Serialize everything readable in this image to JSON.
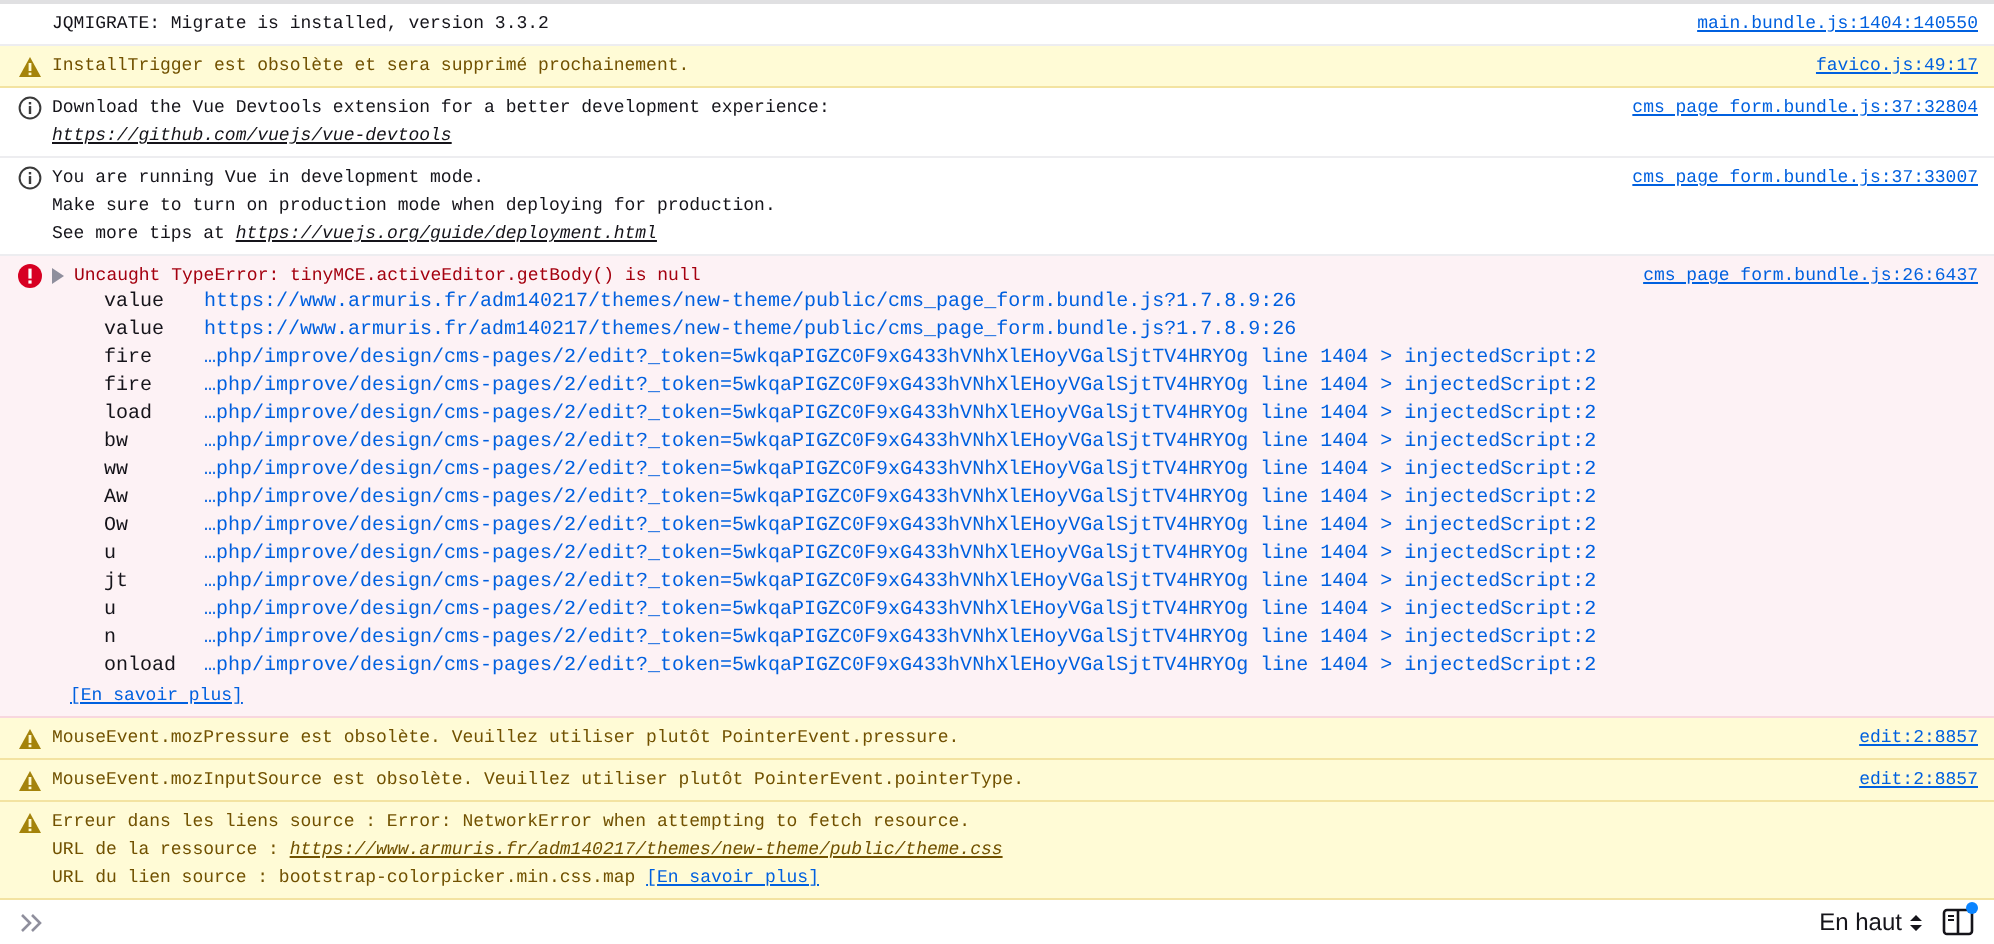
{
  "messages": [
    {
      "kind": "log",
      "lines": [
        [
          {
            "kind": "plain",
            "text": "JQMIGRATE: Migrate is installed, version 3.3.2"
          }
        ]
      ],
      "source": "main.bundle.js:1404:140550"
    },
    {
      "kind": "warning",
      "lines": [
        [
          {
            "kind": "plain",
            "text": "InstallTrigger est obsolète et sera supprimé prochainement."
          }
        ]
      ],
      "source": "favico.js:49:17"
    },
    {
      "kind": "info",
      "lines": [
        [
          {
            "kind": "plain",
            "text": "Download the Vue Devtools extension for a better development experience:"
          }
        ],
        [
          {
            "kind": "url",
            "text": "https://github.com/vuejs/vue-devtools"
          }
        ]
      ],
      "source": "cms page form.bundle.js:37:32804"
    },
    {
      "kind": "info",
      "lines": [
        [
          {
            "kind": "plain",
            "text": "You are running Vue in development mode."
          }
        ],
        [
          {
            "kind": "plain",
            "text": "Make sure to turn on production mode when deploying for production."
          }
        ],
        [
          {
            "kind": "plain",
            "text": "See more tips at "
          },
          {
            "kind": "url",
            "text": "https://vuejs.org/guide/deployment.html"
          }
        ]
      ],
      "source": "cms page form.bundle.js:37:33007"
    },
    {
      "kind": "error",
      "expanded": false,
      "lines": [
        [
          {
            "kind": "plain",
            "text": "Uncaught TypeError: tinyMCE.activeEditor.getBody() is null"
          }
        ]
      ],
      "source": "cms page form.bundle.js:26:6437",
      "stack": [
        {
          "fn": "value",
          "location": "https://www.armuris.fr/adm140217/themes/new-theme/public/cms_page_form.bundle.js?1.7.8.9:26"
        },
        {
          "fn": "value",
          "location": "https://www.armuris.fr/adm140217/themes/new-theme/public/cms_page_form.bundle.js?1.7.8.9:26"
        },
        {
          "fn": "fire",
          "location": "…php/improve/design/cms-pages/2/edit?_token=5wkqaPIGZC0F9xG433hVNhXlEHoyVGalSjtTV4HRYOg line 1404 > injectedScript:2"
        },
        {
          "fn": "fire",
          "location": "…php/improve/design/cms-pages/2/edit?_token=5wkqaPIGZC0F9xG433hVNhXlEHoyVGalSjtTV4HRYOg line 1404 > injectedScript:2"
        },
        {
          "fn": "load",
          "location": "…php/improve/design/cms-pages/2/edit?_token=5wkqaPIGZC0F9xG433hVNhXlEHoyVGalSjtTV4HRYOg line 1404 > injectedScript:2"
        },
        {
          "fn": "bw",
          "location": "…php/improve/design/cms-pages/2/edit?_token=5wkqaPIGZC0F9xG433hVNhXlEHoyVGalSjtTV4HRYOg line 1404 > injectedScript:2"
        },
        {
          "fn": "ww",
          "location": "…php/improve/design/cms-pages/2/edit?_token=5wkqaPIGZC0F9xG433hVNhXlEHoyVGalSjtTV4HRYOg line 1404 > injectedScript:2"
        },
        {
          "fn": "Aw",
          "location": "…php/improve/design/cms-pages/2/edit?_token=5wkqaPIGZC0F9xG433hVNhXlEHoyVGalSjtTV4HRYOg line 1404 > injectedScript:2"
        },
        {
          "fn": "Ow",
          "location": "…php/improve/design/cms-pages/2/edit?_token=5wkqaPIGZC0F9xG433hVNhXlEHoyVGalSjtTV4HRYOg line 1404 > injectedScript:2"
        },
        {
          "fn": "u",
          "location": "…php/improve/design/cms-pages/2/edit?_token=5wkqaPIGZC0F9xG433hVNhXlEHoyVGalSjtTV4HRYOg line 1404 > injectedScript:2"
        },
        {
          "fn": "jt",
          "location": "…php/improve/design/cms-pages/2/edit?_token=5wkqaPIGZC0F9xG433hVNhXlEHoyVGalSjtTV4HRYOg line 1404 > injectedScript:2"
        },
        {
          "fn": "u",
          "location": "…php/improve/design/cms-pages/2/edit?_token=5wkqaPIGZC0F9xG433hVNhXlEHoyVGalSjtTV4HRYOg line 1404 > injectedScript:2"
        },
        {
          "fn": "n",
          "location": "…php/improve/design/cms-pages/2/edit?_token=5wkqaPIGZC0F9xG433hVNhXlEHoyVGalSjtTV4HRYOg line 1404 > injectedScript:2"
        },
        {
          "fn": "onload",
          "location": "…php/improve/design/cms-pages/2/edit?_token=5wkqaPIGZC0F9xG433hVNhXlEHoyVGalSjtTV4HRYOg line 1404 > injectedScript:2"
        }
      ],
      "learn_more": "[En savoir plus]"
    },
    {
      "kind": "warning",
      "lines": [
        [
          {
            "kind": "plain",
            "text": "MouseEvent.mozPressure est obsolète. Veuillez utiliser plutôt PointerEvent.pressure."
          }
        ]
      ],
      "source": "edit:2:8857"
    },
    {
      "kind": "warning",
      "lines": [
        [
          {
            "kind": "plain",
            "text": "MouseEvent.mozInputSource est obsolète. Veuillez utiliser plutôt PointerEvent.pointerType."
          }
        ]
      ],
      "source": "edit:2:8857"
    },
    {
      "kind": "warning",
      "lines": [
        [
          {
            "kind": "plain",
            "text": "Erreur dans les liens source : Error: NetworkError when attempting to fetch resource."
          }
        ],
        [
          {
            "kind": "plain",
            "text": "URL de la ressource : "
          },
          {
            "kind": "url",
            "text": "https://www.armuris.fr/adm140217/themes/new-theme/public/theme.css"
          }
        ],
        [
          {
            "kind": "plain",
            "text": "URL du lien source : bootstrap-colorpicker.min.css.map "
          },
          {
            "kind": "link",
            "text": "[En savoir plus]"
          }
        ]
      ]
    }
  ],
  "footer": {
    "position": "En haut",
    "sidebar_badge": true
  }
}
